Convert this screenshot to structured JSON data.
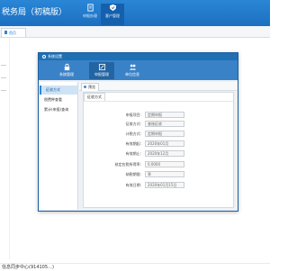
{
  "app": {
    "title": "税务局（初稿版）"
  },
  "toolbar": {
    "buttons": [
      {
        "label": "申报办理",
        "icon": "document-icon"
      },
      {
        "label": "客户管理",
        "icon": "shield-icon"
      }
    ]
  },
  "tabs": {
    "home": "首页"
  },
  "window": {
    "title": "系统设置",
    "nav": [
      {
        "label": "系统管理",
        "icon": "lock-icon"
      },
      {
        "label": "申报管理",
        "icon": "edit-icon"
      },
      {
        "label": "单位信息",
        "icon": "users-icon"
      }
    ],
    "sidebar": [
      "征收方式",
      "税费种查看",
      "累计(申报)查询"
    ],
    "content_tab": "预览",
    "panel_title": "征收方式",
    "fields": [
      {
        "label": "申报项目:",
        "value": "定期申报"
      },
      {
        "label": "征收方式:",
        "value": "查账征收"
      },
      {
        "label": "计税方式:",
        "value": "定期申报"
      },
      {
        "label": "有效期起:",
        "value": "2020年01月"
      },
      {
        "label": "有效期止:",
        "value": "2020年12月"
      },
      {
        "label": "核定应税所得率:",
        "value": "0.0000"
      },
      {
        "label": "纳税期限:",
        "value": "季"
      },
      {
        "label": "有效日期:",
        "value": "2020年01月15日"
      }
    ]
  },
  "status": {
    "text": "信息同步中心(914105…)"
  },
  "colors": {
    "header": "#1d6fc0",
    "window_nav": "#3a82c8",
    "accent": "#2f86d8"
  }
}
